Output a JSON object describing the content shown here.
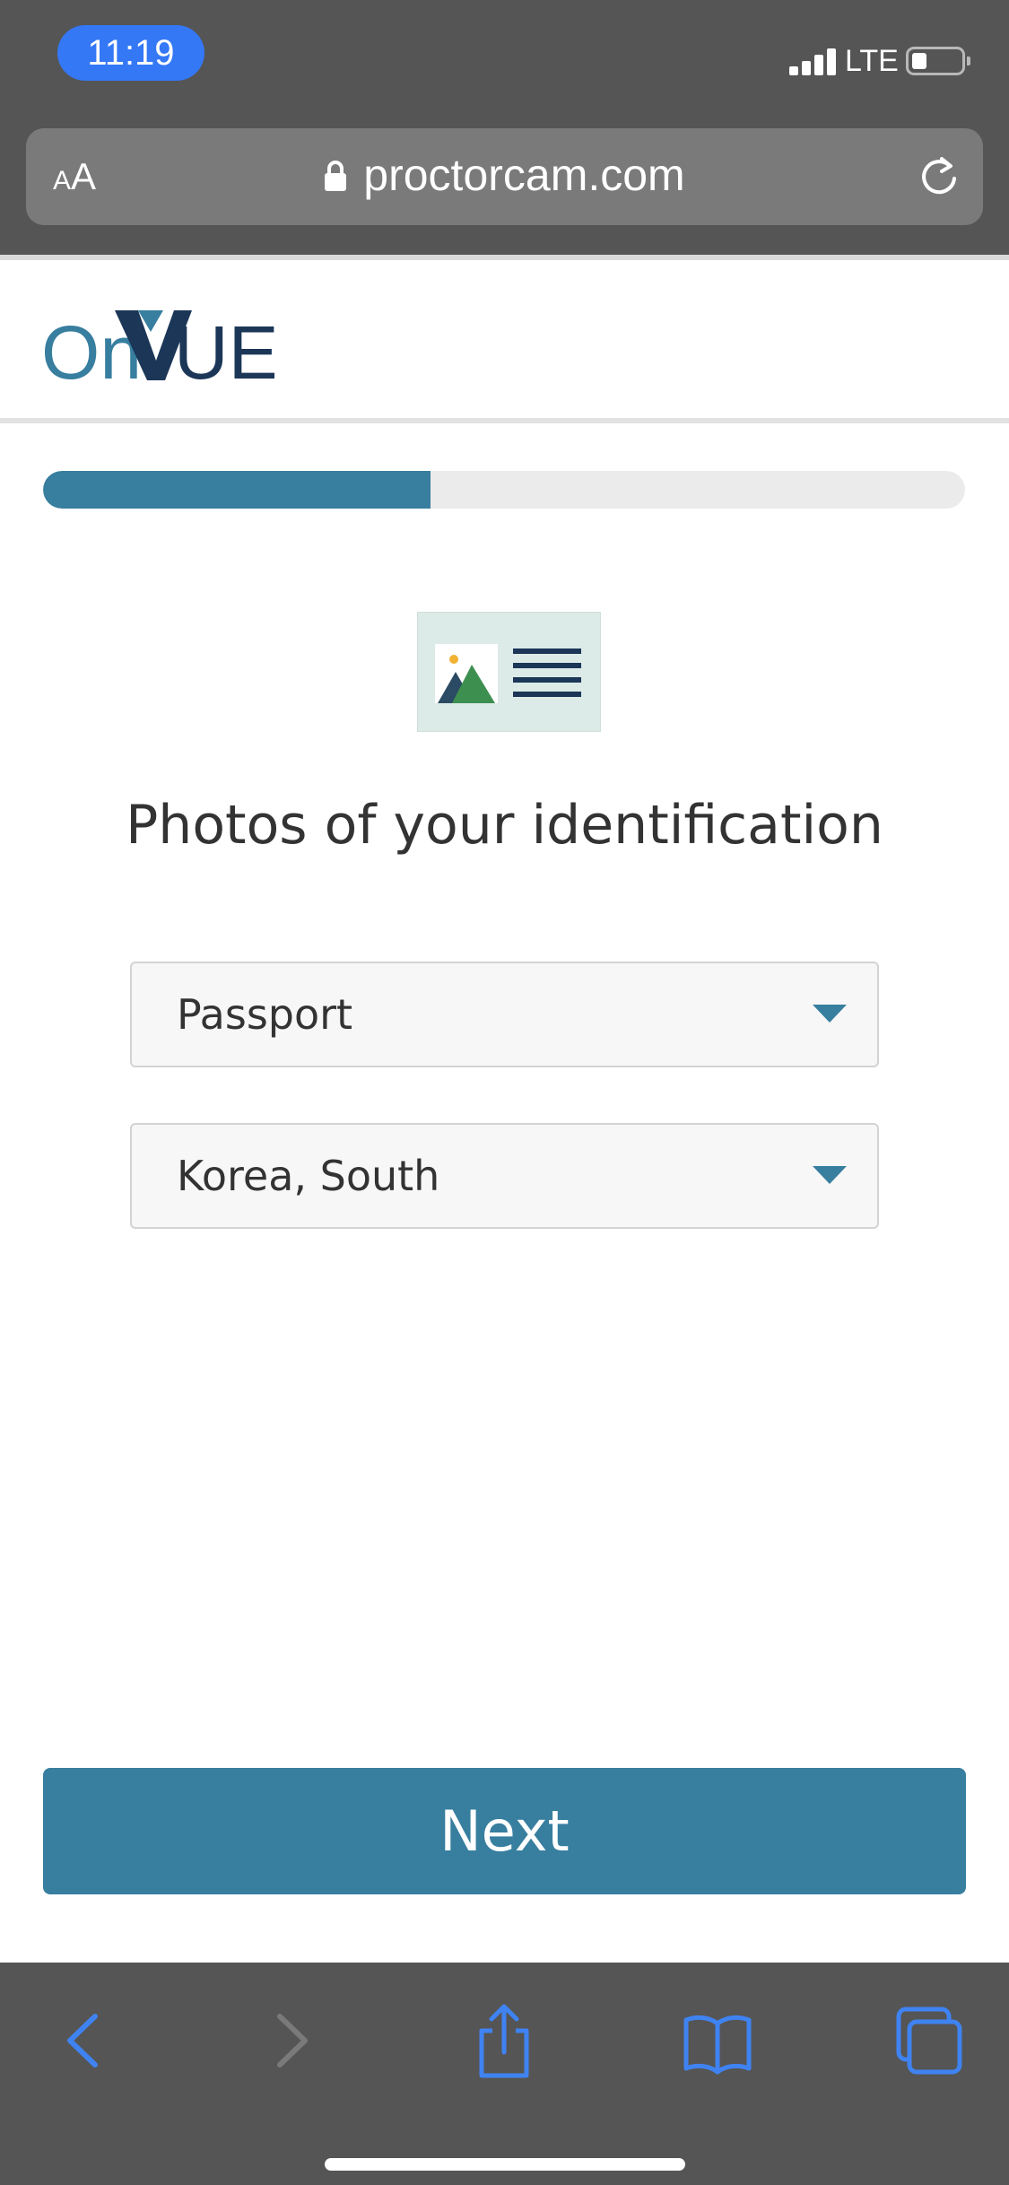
{
  "status_bar": {
    "time": "11:19",
    "network": "LTE"
  },
  "address_bar": {
    "text_size_small": "A",
    "text_size_large": "A",
    "url": "proctorcam.com"
  },
  "header": {
    "logo_text": "OnVUE",
    "logo_colors": {
      "on": "#377e9f",
      "vue": "#1b3657",
      "chevron_accent": "#377e9f"
    }
  },
  "progress": {
    "fraction": 0.42,
    "color": "#377e9f"
  },
  "main": {
    "title": "Photos of your identification",
    "id_type_select": {
      "value": "Passport"
    },
    "country_select": {
      "value": "Korea, South"
    },
    "next_label": "Next"
  },
  "toolbar": {
    "icons": [
      "back-icon",
      "forward-icon",
      "share-icon",
      "bookmarks-icon",
      "tabs-icon"
    ],
    "accent_color": "#3f83f2"
  },
  "colors": {
    "brand": "#377e9f",
    "chrome": "#555555"
  }
}
